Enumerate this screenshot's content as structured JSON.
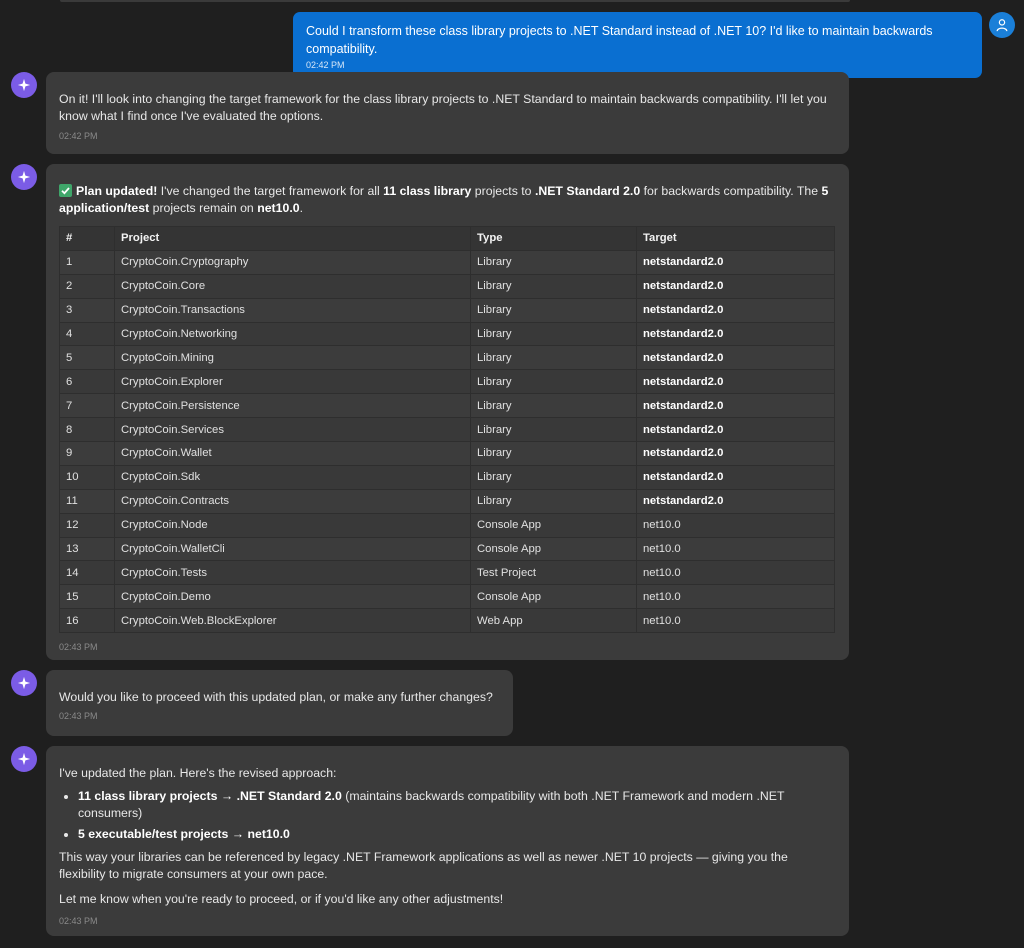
{
  "user_message": {
    "text": "Could I transform these class library projects to .NET Standard instead of .NET 10? I'd like to maintain backwards compatibility.",
    "time": "02:42 PM",
    "avatar_icon": "user-icon"
  },
  "assistant_icon": "sparkle-icon",
  "messages": [
    {
      "text": "On it! I'll look into changing the target framework for the class library projects to .NET Standard to maintain backwards compatibility. I'll let you know what I find once I've evaluated the options.",
      "time": "02:42 PM"
    },
    {
      "status_icon": "check-mark-icon",
      "intro": {
        "strong1": "Plan updated!",
        "t1": " I've changed the target framework for all ",
        "strong2": "11 class library",
        "t2": " projects to ",
        "strong3": ".NET Standard 2.0",
        "t3": " for backwards compatibility. The ",
        "strong4": "5 application/test",
        "t4": " projects remain on ",
        "strong5": "net10.0",
        "t5": "."
      },
      "table": {
        "headers": [
          "#",
          "Project",
          "Type",
          "Target"
        ],
        "rows": [
          [
            "1",
            "CryptoCoin.Cryptography",
            "Library",
            "netstandard2.0"
          ],
          [
            "2",
            "CryptoCoin.Core",
            "Library",
            "netstandard2.0"
          ],
          [
            "3",
            "CryptoCoin.Transactions",
            "Library",
            "netstandard2.0"
          ],
          [
            "4",
            "CryptoCoin.Networking",
            "Library",
            "netstandard2.0"
          ],
          [
            "5",
            "CryptoCoin.Mining",
            "Library",
            "netstandard2.0"
          ],
          [
            "6",
            "CryptoCoin.Explorer",
            "Library",
            "netstandard2.0"
          ],
          [
            "7",
            "CryptoCoin.Persistence",
            "Library",
            "netstandard2.0"
          ],
          [
            "8",
            "CryptoCoin.Services",
            "Library",
            "netstandard2.0"
          ],
          [
            "9",
            "CryptoCoin.Wallet",
            "Library",
            "netstandard2.0"
          ],
          [
            "10",
            "CryptoCoin.Sdk",
            "Library",
            "netstandard2.0"
          ],
          [
            "11",
            "CryptoCoin.Contracts",
            "Library",
            "netstandard2.0"
          ],
          [
            "12",
            "CryptoCoin.Node",
            "Console App",
            "net10.0"
          ],
          [
            "13",
            "CryptoCoin.WalletCli",
            "Console App",
            "net10.0"
          ],
          [
            "14",
            "CryptoCoin.Tests",
            "Test Project",
            "net10.0"
          ],
          [
            "15",
            "CryptoCoin.Demo",
            "Console App",
            "net10.0"
          ],
          [
            "16",
            "CryptoCoin.Web.BlockExplorer",
            "Web App",
            "net10.0"
          ]
        ]
      },
      "time": "02:43 PM"
    },
    {
      "text": "Would you like to proceed with this updated plan, or make any further changes?",
      "time": "02:43 PM"
    },
    {
      "intro": "I've updated the plan. Here's the revised approach:",
      "bullets": [
        {
          "strong": "11 class library projects → .NET Standard 2.0",
          "rest": " (maintains backwards compatibility with both .NET Framework and modern .NET consumers)"
        },
        {
          "strong": "5 executable/test projects → net10.0",
          "rest": ""
        }
      ],
      "para1": "This way your libraries can be referenced by legacy .NET Framework applications as well as newer .NET 10 projects — giving you the flexibility to migrate consumers at your own pace.",
      "para2": "Let me know when you're ready to proceed, or if you'd like any other adjustments!",
      "time": "02:43 PM"
    }
  ],
  "colors": {
    "background": "#1f1f1f",
    "user_bubble": "#0a6fd1",
    "assistant_bubble": "#3b3b3b",
    "assistant_avatar": "#7b5ce6",
    "check": "#3fa66a"
  }
}
